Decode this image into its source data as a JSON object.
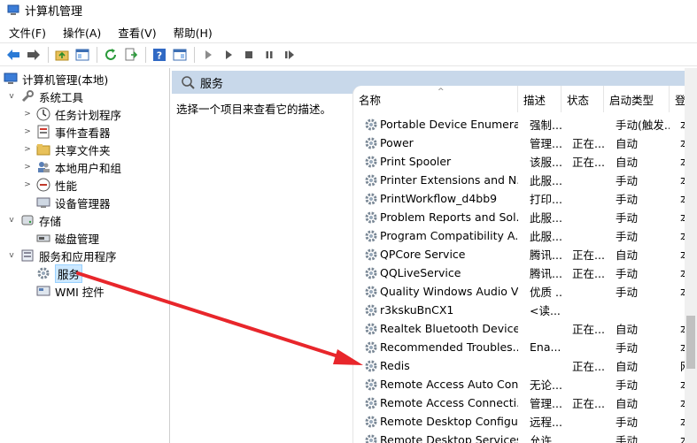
{
  "window": {
    "title": "计算机管理"
  },
  "menu": [
    "文件(F)",
    "操作(A)",
    "查看(V)",
    "帮助(H)"
  ],
  "tree": [
    {
      "label": "计算机管理(本地)",
      "level": 0,
      "expander": "",
      "icon": "computer-management-icon"
    },
    {
      "label": "系统工具",
      "level": 1,
      "expander": "v",
      "icon": "system-tools-icon"
    },
    {
      "label": "任务计划程序",
      "level": 2,
      "expander": ">",
      "icon": "task-scheduler-icon"
    },
    {
      "label": "事件查看器",
      "level": 2,
      "expander": ">",
      "icon": "event-viewer-icon"
    },
    {
      "label": "共享文件夹",
      "level": 2,
      "expander": ">",
      "icon": "shared-folders-icon"
    },
    {
      "label": "本地用户和组",
      "level": 2,
      "expander": ">",
      "icon": "local-users-icon"
    },
    {
      "label": "性能",
      "level": 2,
      "expander": ">",
      "icon": "performance-icon"
    },
    {
      "label": "设备管理器",
      "level": 2,
      "expander": "",
      "icon": "device-manager-icon"
    },
    {
      "label": "存储",
      "level": 1,
      "expander": "v",
      "icon": "storage-icon"
    },
    {
      "label": "磁盘管理",
      "level": 2,
      "expander": "",
      "icon": "disk-management-icon"
    },
    {
      "label": "服务和应用程序",
      "level": 1,
      "expander": "v",
      "icon": "services-apps-icon"
    },
    {
      "label": "服务",
      "level": 2,
      "expander": "",
      "icon": "services-gear-icon",
      "selected": true
    },
    {
      "label": "WMI 控件",
      "level": 2,
      "expander": "",
      "icon": "wmi-control-icon"
    }
  ],
  "panel": {
    "title": "服务",
    "description": "选择一个项目来查看它的描述。"
  },
  "columns": [
    "名称",
    "描述",
    "状态",
    "启动类型",
    "登"
  ],
  "services": [
    {
      "name": "Portable Device Enumera...",
      "desc": "强制...",
      "status": "",
      "startup": "手动(触发...",
      "logon": "本"
    },
    {
      "name": "Power",
      "desc": "管理...",
      "status": "正在...",
      "startup": "自动",
      "logon": "本"
    },
    {
      "name": "Print Spooler",
      "desc": "该服...",
      "status": "正在...",
      "startup": "自动",
      "logon": "本"
    },
    {
      "name": "Printer Extensions and N...",
      "desc": "此服...",
      "status": "",
      "startup": "手动",
      "logon": "本"
    },
    {
      "name": "PrintWorkflow_d4bb9",
      "desc": "打印...",
      "status": "",
      "startup": "手动",
      "logon": "本"
    },
    {
      "name": "Problem Reports and Sol...",
      "desc": "此服...",
      "status": "",
      "startup": "手动",
      "logon": "本"
    },
    {
      "name": "Program Compatibility A...",
      "desc": "此服...",
      "status": "",
      "startup": "手动",
      "logon": "本"
    },
    {
      "name": "QPCore Service",
      "desc": "腾讯...",
      "status": "正在...",
      "startup": "自动",
      "logon": "本"
    },
    {
      "name": "QQLiveService",
      "desc": "腾讯...",
      "status": "正在...",
      "startup": "手动",
      "logon": "本"
    },
    {
      "name": "Quality Windows Audio V...",
      "desc": "优质 ...",
      "status": "",
      "startup": "手动",
      "logon": "本"
    },
    {
      "name": "r3kskuBnCX1",
      "desc": "<读...",
      "status": "",
      "startup": "",
      "logon": ""
    },
    {
      "name": "Realtek Bluetooth Device...",
      "desc": "",
      "status": "正在...",
      "startup": "自动",
      "logon": "本"
    },
    {
      "name": "Recommended Troubles...",
      "desc": "Ena...",
      "status": "",
      "startup": "手动",
      "logon": "本"
    },
    {
      "name": "Redis",
      "desc": "",
      "status": "正在...",
      "startup": "自动",
      "logon": "网"
    },
    {
      "name": "Remote Access Auto Con...",
      "desc": "无论...",
      "status": "",
      "startup": "手动",
      "logon": "本"
    },
    {
      "name": "Remote Access Connecti...",
      "desc": "管理...",
      "status": "正在...",
      "startup": "自动",
      "logon": "本"
    },
    {
      "name": "Remote Desktop Configu...",
      "desc": "远程...",
      "status": "",
      "startup": "手动",
      "logon": "本"
    },
    {
      "name": "Remote Desktop Services",
      "desc": "允许...",
      "status": "",
      "startup": "手动",
      "logon": "本"
    }
  ],
  "colors": {
    "accent_header": "#c8d8ea",
    "selection": "#cce8ff",
    "arrow": "#e8262b"
  }
}
